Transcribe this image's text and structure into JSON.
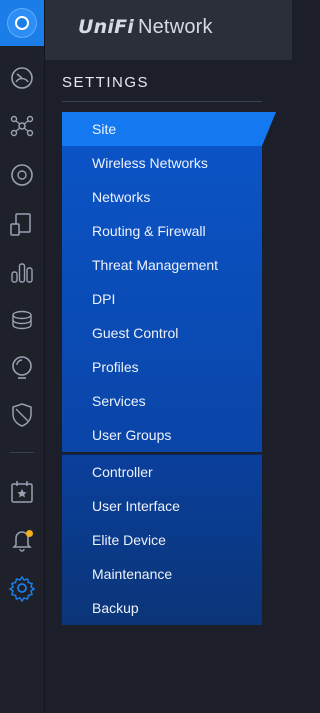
{
  "header": {
    "brand_unifi": "UniFi",
    "brand_network": "Network"
  },
  "settings": {
    "title": "SETTINGS",
    "groups": [
      {
        "items": [
          {
            "label": "Site",
            "active": true
          },
          {
            "label": "Wireless Networks"
          },
          {
            "label": "Networks"
          },
          {
            "label": "Routing & Firewall"
          },
          {
            "label": "Threat Management"
          },
          {
            "label": "DPI"
          },
          {
            "label": "Guest Control"
          },
          {
            "label": "Profiles"
          },
          {
            "label": "Services"
          },
          {
            "label": "User Groups"
          }
        ]
      },
      {
        "items": [
          {
            "label": "Controller"
          },
          {
            "label": "User Interface"
          },
          {
            "label": "Elite Device"
          },
          {
            "label": "Maintenance"
          },
          {
            "label": "Backup"
          }
        ]
      }
    ]
  },
  "rail": {
    "icons": [
      "dashboard-icon",
      "topology-icon",
      "devices-icon",
      "clients-icon",
      "statistics-icon",
      "insights-icon",
      "alerts-icon",
      "security-icon",
      "events-icon",
      "notifications-icon",
      "settings-icon"
    ]
  },
  "colors": {
    "accent": "#1479f0",
    "active_icon": "#1b7ee8",
    "notification": "#f3b01c"
  }
}
